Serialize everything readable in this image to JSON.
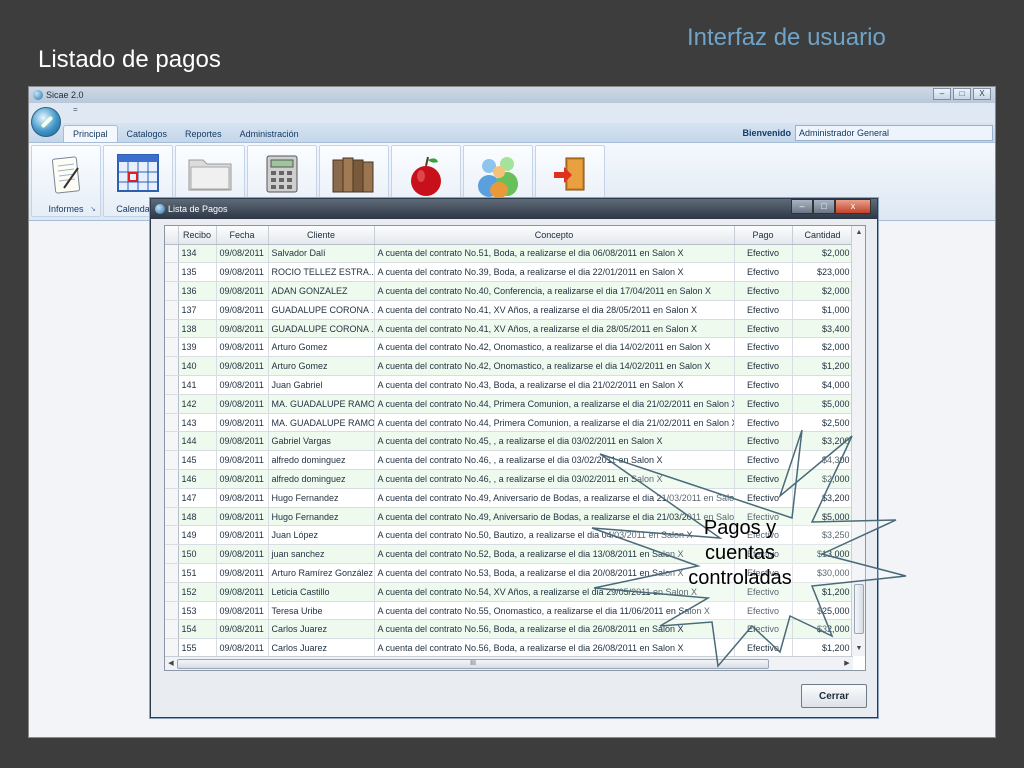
{
  "slide": {
    "title": "Listado de pagos",
    "subtitle": "Interfaz de usuario"
  },
  "app": {
    "window_title": "Sicae 2.0",
    "window_buttons": [
      "–",
      "□",
      "X"
    ],
    "quick_access": "=",
    "tabs": [
      "Principal",
      "Catalogos",
      "Reportes",
      "Administración"
    ],
    "active_tab": "Principal",
    "welcome_label": "Bienvenido",
    "welcome_user": "Administrador General",
    "ribbon": {
      "informes_label": "Informes",
      "calendario_label": "Calendario",
      "corner": "↘"
    }
  },
  "dialog": {
    "title": "Lista de Pagos",
    "buttons": [
      "–",
      "□",
      "x"
    ],
    "close_button": "Cerrar",
    "scroll_grip": "III",
    "columns": [
      "Recibo",
      "Fecha",
      "Cliente",
      "Concepto",
      "Pago",
      "Cantidad"
    ],
    "rows": [
      [
        "134",
        "09/08/2011",
        "Salvador Dalí",
        "A cuenta del contrato No.51, Boda, a realizarse el dia 06/08/2011 en Salon X",
        "Efectivo",
        "$2,000"
      ],
      [
        "135",
        "09/08/2011",
        "ROCIO TELLEZ ESTRA...",
        "A cuenta del contrato No.39, Boda, a realizarse el dia 22/01/2011 en Salon X",
        "Efectivo",
        "$23,000"
      ],
      [
        "136",
        "09/08/2011",
        "ADAN GONZALEZ",
        "A cuenta del contrato No.40, Conferencia, a realizarse el dia 17/04/2011 en Salon X",
        "Efectivo",
        "$2,000"
      ],
      [
        "137",
        "09/08/2011",
        "GUADALUPE CORONA ...",
        "A cuenta del contrato No.41, XV Años, a realizarse el dia 28/05/2011 en Salon X",
        "Efectivo",
        "$1,000"
      ],
      [
        "138",
        "09/08/2011",
        "GUADALUPE CORONA ...",
        "A cuenta del contrato No.41, XV Años, a realizarse el dia 28/05/2011 en Salon X",
        "Efectivo",
        "$3,400"
      ],
      [
        "139",
        "09/08/2011",
        "Arturo Gomez",
        "A cuenta del contrato No.42, Onomastico, a realizarse el dia 14/02/2011 en Salon X",
        "Efectivo",
        "$2,000"
      ],
      [
        "140",
        "09/08/2011",
        "Arturo Gomez",
        "A cuenta del contrato No.42, Onomastico, a realizarse el dia 14/02/2011 en Salon X",
        "Efectivo",
        "$1,200"
      ],
      [
        "141",
        "09/08/2011",
        "Juan Gabriel",
        "A cuenta del contrato No.43, Boda, a realizarse el dia 21/02/2011 en Salon X",
        "Efectivo",
        "$4,000"
      ],
      [
        "142",
        "09/08/2011",
        "MA. GUADALUPE RAMO...",
        "A cuenta del contrato No.44, Primera Comunion, a realizarse el dia 21/02/2011 en Salon X",
        "Efectivo",
        "$5,000"
      ],
      [
        "143",
        "09/08/2011",
        "MA. GUADALUPE RAMO...",
        "A cuenta del contrato No.44, Primera Comunion, a realizarse el dia 21/02/2011 en Salon X",
        "Efectivo",
        "$2,500"
      ],
      [
        "144",
        "09/08/2011",
        "Gabriel Vargas",
        "A cuenta del contrato No.45, , a realizarse el dia 03/02/2011 en Salon X",
        "Efectivo",
        "$3,200"
      ],
      [
        "145",
        "09/08/2011",
        "alfredo dominguez",
        "A cuenta del contrato No.46, , a realizarse el dia 03/02/2011 en Salon X",
        "Efectivo",
        "$4,300"
      ],
      [
        "146",
        "09/08/2011",
        "alfredo dominguez",
        "A cuenta del contrato No.46, , a realizarse el dia 03/02/2011 en Salon X",
        "Efectivo",
        "$2,000"
      ],
      [
        "147",
        "09/08/2011",
        "Hugo Fernandez",
        "A cuenta del contrato No.49, Aniversario de Bodas, a realizarse el dia 21/03/2011 en Salo...",
        "Efectivo",
        "$3,200"
      ],
      [
        "148",
        "09/08/2011",
        "Hugo Fernandez",
        "A cuenta del contrato No.49, Aniversario de Bodas, a realizarse el dia 21/03/2011 en Salo...",
        "Efectivo",
        "$5,000"
      ],
      [
        "149",
        "09/08/2011",
        "Juan López",
        "A cuenta del contrato No.50, Bautizo, a realizarse el dia 04/03/2011 en Salon X",
        "Efectivo",
        "$3,250"
      ],
      [
        "150",
        "09/08/2011",
        "juan sanchez",
        "A cuenta del contrato No.52, Boda, a realizarse el dia 13/08/2011 en Salon X",
        "Efectivo",
        "$13,000"
      ],
      [
        "151",
        "09/08/2011",
        "Arturo Ramírez González",
        "A cuenta del contrato No.53, Boda, a realizarse el dia 20/08/2011 en Salon X",
        "Efectivo",
        "$30,000"
      ],
      [
        "152",
        "09/08/2011",
        "Leticia Castillo",
        "A cuenta del contrato No.54, XV Años, a realizarse el dia 29/05/2011 en Salon X",
        "Efectivo",
        "$1,200"
      ],
      [
        "153",
        "09/08/2011",
        "Teresa Uribe",
        "A cuenta del contrato No.55, Onomastico, a realizarse el dia 11/06/2011 en Salon X",
        "Efectivo",
        "$25,000"
      ],
      [
        "154",
        "09/08/2011",
        "Carlos Juarez",
        "A cuenta del contrato No.56, Boda, a realizarse el dia 26/08/2011 en Salon X",
        "Efectivo",
        "$32,000"
      ],
      [
        "155",
        "09/08/2011",
        "Carlos Juarez",
        "A cuenta del contrato No.56, Boda, a realizarse el dia 26/08/2011 en Salon X",
        "Efectivo",
        "$1,200"
      ]
    ]
  },
  "callout": {
    "text": "Pagos y cuentas controladas"
  }
}
